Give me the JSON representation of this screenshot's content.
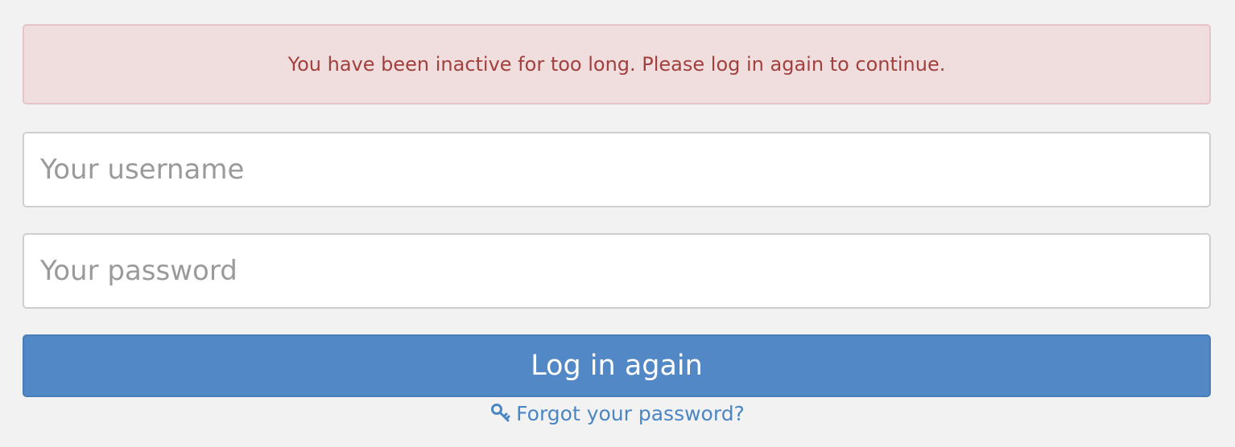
{
  "alert": {
    "message": "You have been inactive for too long. Please log in again to continue."
  },
  "form": {
    "username_placeholder": "Your username",
    "password_placeholder": "Your password",
    "submit_label": "Log in again"
  },
  "forgot_link": {
    "label": "Forgot your password?",
    "icon": "key-icon"
  },
  "colors": {
    "background": "#f2f2f2",
    "alert_background": "#f0dedf",
    "alert_text": "#a2403d",
    "button": "#5288c6",
    "link": "#4a86c4"
  }
}
